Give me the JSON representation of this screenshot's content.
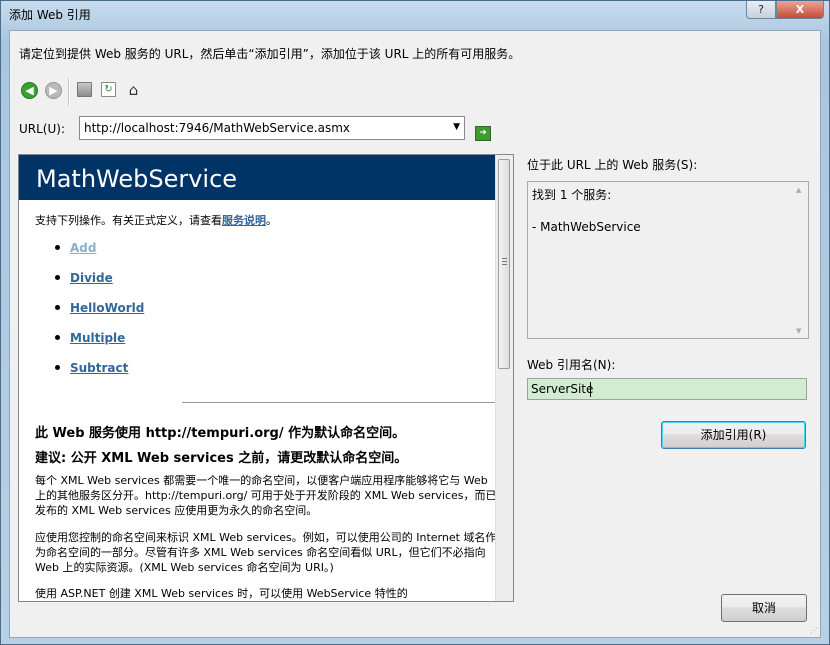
{
  "window": {
    "title": "添加 Web 引用",
    "help_label": "?",
    "close_label": "X"
  },
  "instruction": "请定位到提供 Web 服务的 URL，然后单击“添加引用”，添加位于该 URL 上的所有可用服务。",
  "toolbar": {
    "icons": [
      "back-icon",
      "forward-icon",
      "stop-icon",
      "refresh-icon",
      "home-icon"
    ]
  },
  "url": {
    "label": "URL(U):",
    "value": "http://localhost:7946/MathWebService.asmx"
  },
  "browser": {
    "service_title": "MathWebService",
    "intro_text": "支持下列操作。有关正式定义，请查看",
    "intro_link": "服务说明",
    "intro_end": "。",
    "operations": [
      "Add",
      "Divide",
      "HelloWorld",
      "Multiple",
      "Subtract"
    ],
    "namespace_line": "此 Web 服务使用 http://tempuri.org/ 作为默认命名空间。",
    "suggestion_line": "建议: 公开 XML Web services 之前，请更改默认命名空间。",
    "para1": "每个 XML Web services 都需要一个唯一的命名空间，以便客户端应用程序能够将它与 Web 上的其他服务区分开。http://tempuri.org/ 可用于处于开发阶段的 XML Web services，而已发布的 XML Web services 应使用更为永久的命名空间。",
    "para2": "应使用您控制的命名空间来标识 XML Web services。例如，可以使用公司的 Internet 域名作为命名空间的一部分。尽管有许多 XML Web services 命名空间看似 URL，但它们不必指向 Web 上的实际资源。(XML Web services 命名空间为 URI。)",
    "para3": "使用 ASP.NET 创建 XML Web services 时，可以使用 WebService 特性的"
  },
  "right_panel": {
    "services_label": "位于此 URL 上的 Web 服务(S):",
    "found_text": "找到 1 个服务:",
    "service_item": "- MathWebService",
    "web_ref_label": "Web 引用名(N):",
    "web_ref_value": "ServerSite",
    "add_button": "添加引用(R)"
  },
  "cancel_button": "取消",
  "colors": {
    "banner_bg": "#003366",
    "link": "#336699",
    "input_highlight": "#d2ecd2"
  }
}
